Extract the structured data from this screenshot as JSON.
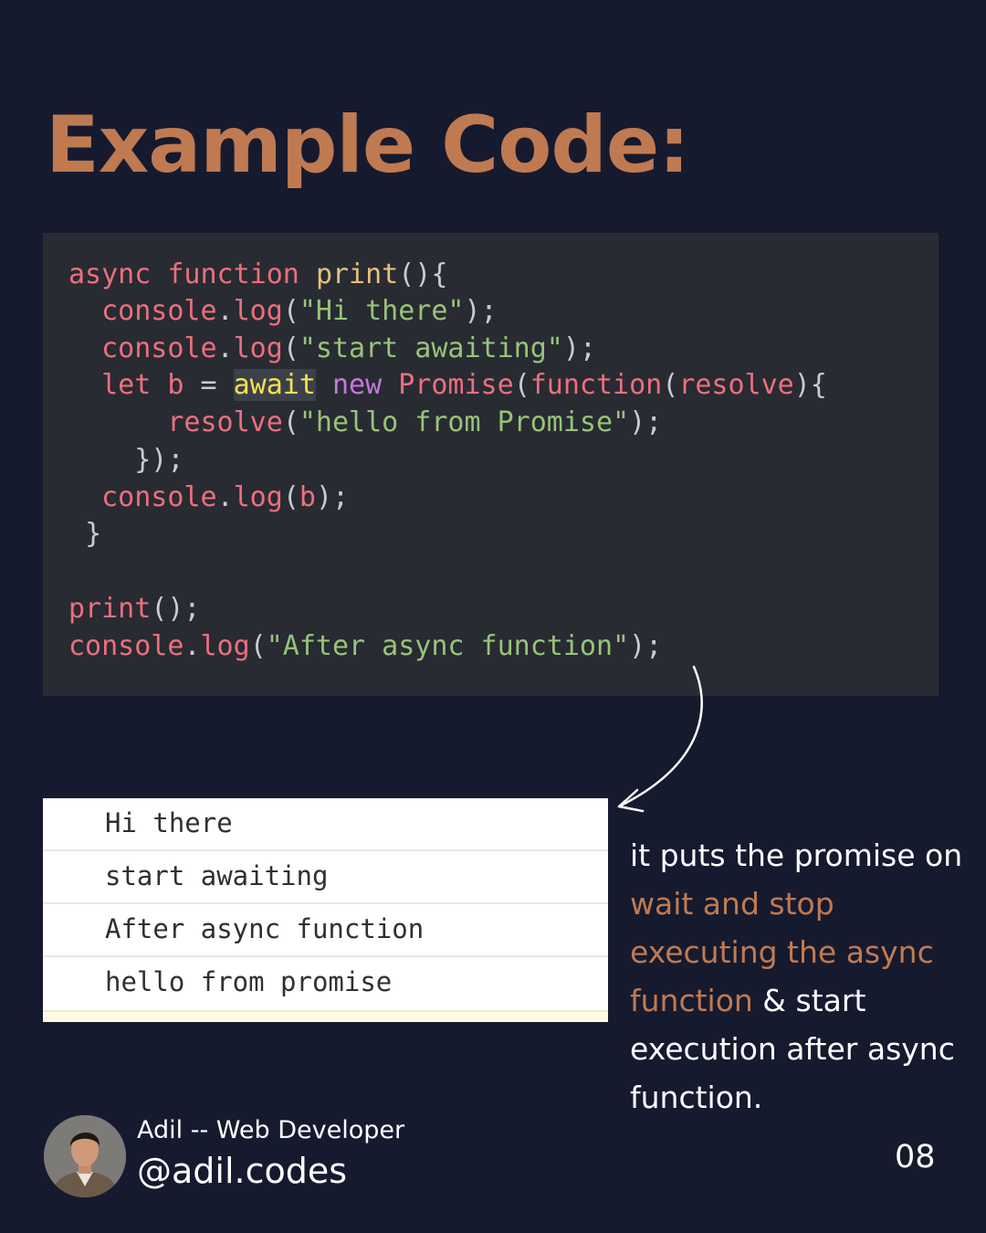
{
  "title": "Example Code:",
  "code": {
    "l1": [
      "async",
      "function",
      "print",
      "(){"
    ],
    "l2": [
      "console",
      ".",
      "log",
      "(",
      "\"Hi there\"",
      ");"
    ],
    "l3": [
      "console",
      ".",
      "log",
      "(",
      "\"start awaiting\"",
      ");"
    ],
    "l4": [
      "let",
      "b",
      "=",
      "await",
      "new",
      "Promise",
      "(",
      "function",
      "(",
      "resolve",
      "){"
    ],
    "l5": [
      "resolve",
      "(",
      "\"hello from Promise\"",
      ");"
    ],
    "l6": "});",
    "l7": [
      "console",
      ".",
      "log",
      "(",
      "b",
      ");"
    ],
    "l8": "}",
    "l9": [
      "print",
      "();"
    ],
    "l10": [
      "console",
      ".",
      "log",
      "(",
      "\"After async function\"",
      ");"
    ]
  },
  "console_output": [
    "Hi there",
    "start awaiting",
    "After async function",
    "hello from promise"
  ],
  "explanation": {
    "part1": "it puts the promise on ",
    "highlight": "wait and stop executing the async function",
    "part2": " & start execution after async function."
  },
  "author": {
    "name": "Adil -- Web Developer",
    "handle": "@adil.codes",
    "avatar_icon": "person-avatar-icon"
  },
  "page_number": "08",
  "colors": {
    "background": "#161a2f",
    "accent": "#c07a51",
    "code_background": "#282b32"
  }
}
